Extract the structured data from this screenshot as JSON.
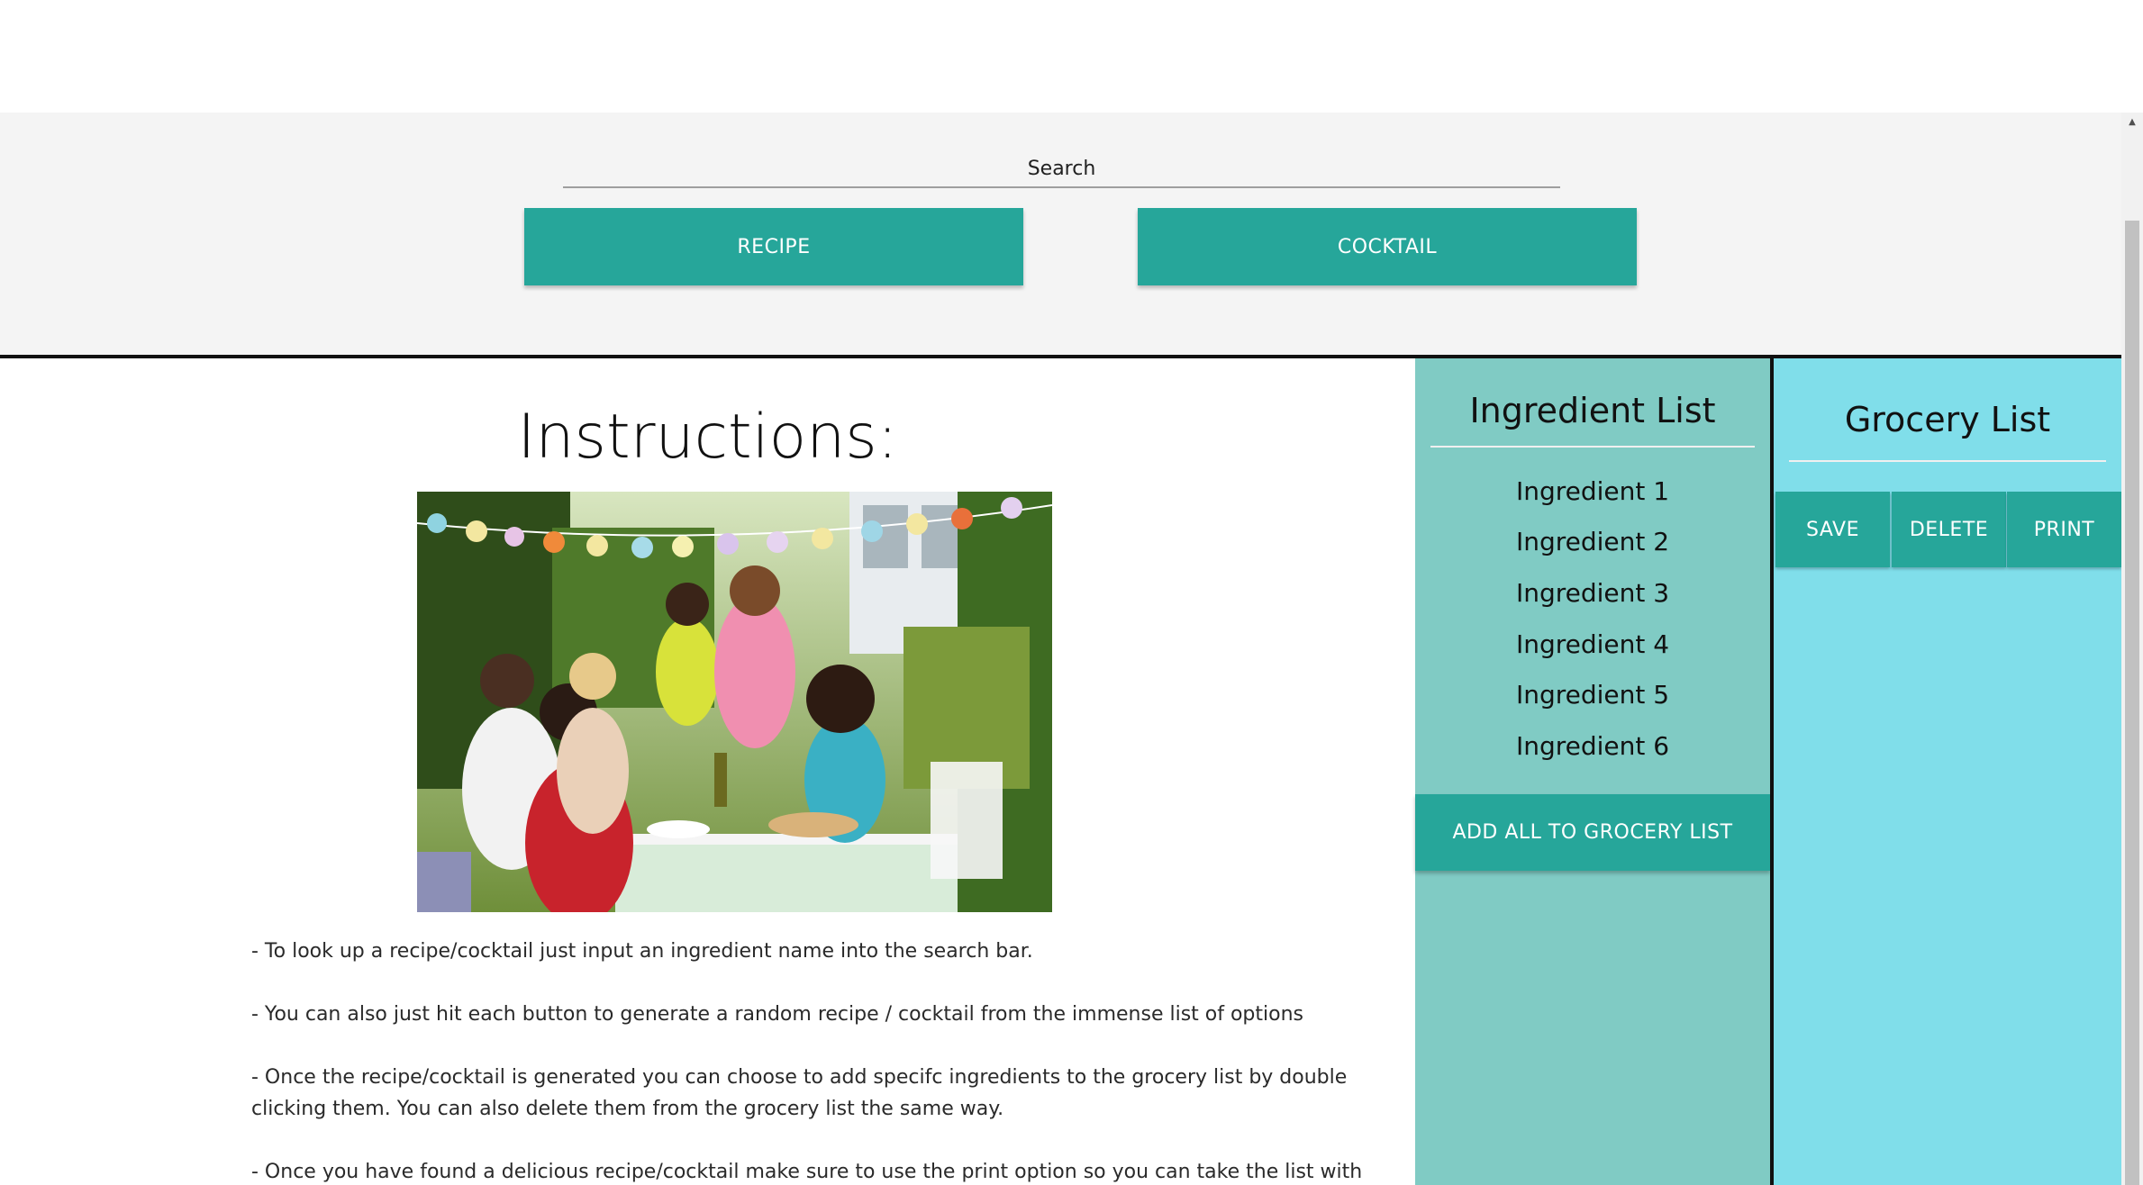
{
  "search": {
    "label": "Search"
  },
  "buttons": {
    "recipe": "RECIPE",
    "cocktail": "COCKTAIL"
  },
  "instructions": {
    "title": "Instructions:",
    "paragraphs": [
      "- To look up a recipe/cocktail just input an ingredient name into the search bar.",
      "- You can also just hit each button to generate a random recipe / cocktail from the immense list of options",
      "- Once the recipe/cocktail is generated you can choose to add specifc ingredients to the grocery list by double clicking them. You can also delete them from the grocery list the same way.",
      "- Once you have found a delicious recipe/cocktail make sure to use the print option so you can take the list with you"
    ]
  },
  "ingredients": {
    "title": "Ingredient List",
    "items": [
      "Ingredient 1",
      "Ingredient 2",
      "Ingredient 3",
      "Ingredient 4",
      "Ingredient 5",
      "Ingredient 6"
    ],
    "add_all": "ADD ALL TO GROCERY LIST"
  },
  "grocery": {
    "title": "Grocery List",
    "save": "SAVE",
    "delete": "DELETE",
    "print": "PRINT"
  },
  "colors": {
    "button": "#26a69a",
    "ingredient_panel": "#80cbc4",
    "grocery_panel": "#80deea",
    "search_bg": "#f4f4f4"
  }
}
